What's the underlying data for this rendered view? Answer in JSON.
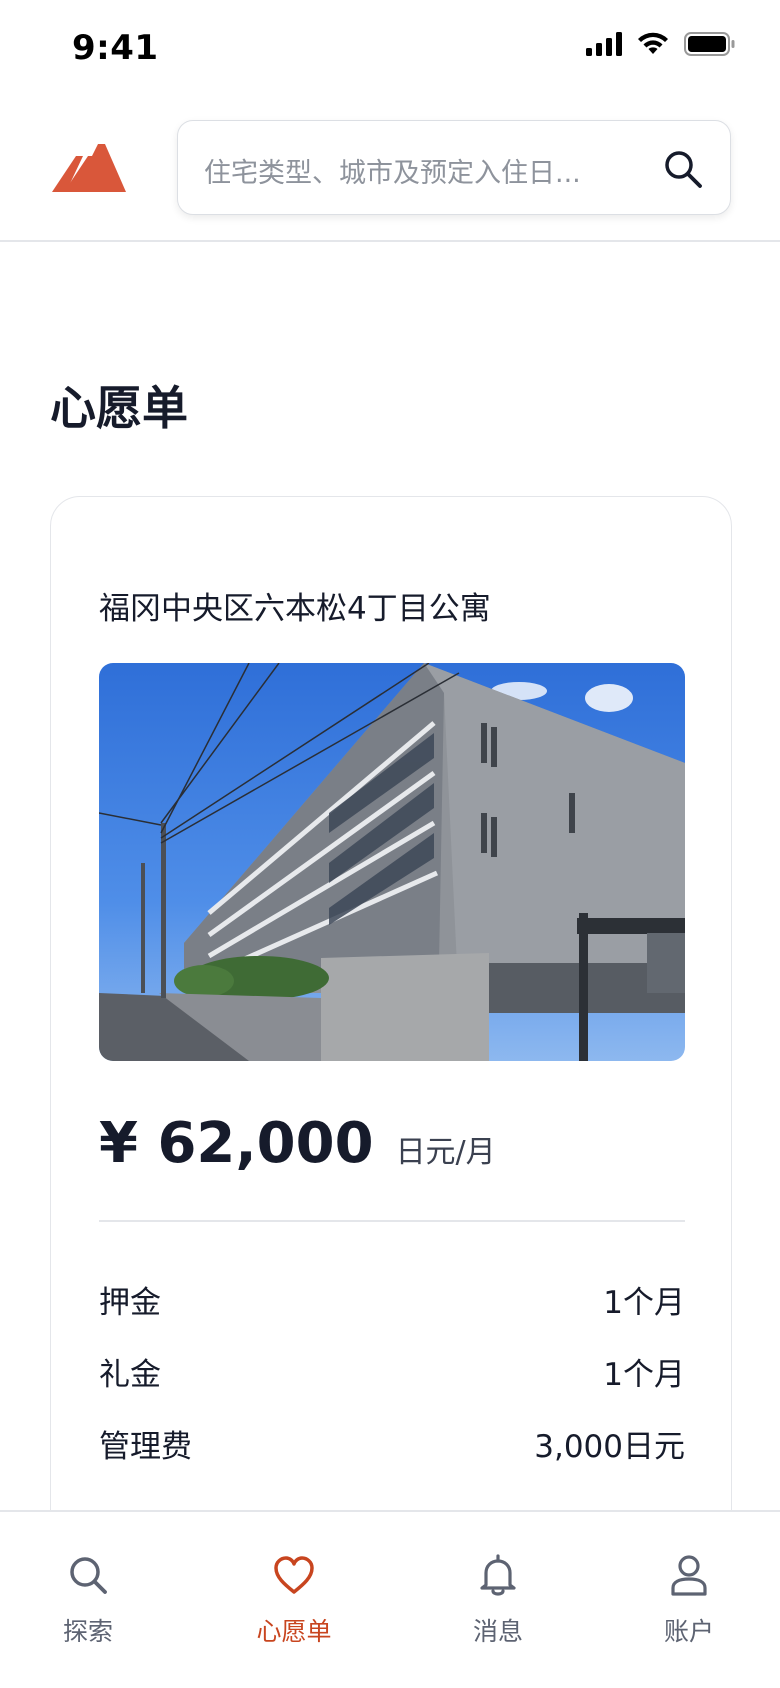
{
  "status_bar": {
    "time": "9:41"
  },
  "header": {
    "search": {
      "placeholder": "住宅类型、城市及预定入住日..."
    }
  },
  "page": {
    "title": "心愿单"
  },
  "listing": {
    "title": "福冈中央区六本松4丁目公寓",
    "price": "¥ 62,000",
    "price_unit": "日元/月",
    "fees": [
      {
        "label": "押金",
        "value": "1个月"
      },
      {
        "label": "礼金",
        "value": "1个月"
      },
      {
        "label": "管理费",
        "value": "3,000日元"
      }
    ]
  },
  "nav": {
    "items": [
      {
        "label": "探索",
        "icon": "search-icon"
      },
      {
        "label": "心愿单",
        "icon": "heart-icon",
        "active": true
      },
      {
        "label": "消息",
        "icon": "bell-icon"
      },
      {
        "label": "账户",
        "icon": "user-icon"
      }
    ]
  },
  "colors": {
    "accent": "#c8451f",
    "logo": "#d9573a",
    "text": "#161b2b",
    "muted": "#5d6372",
    "border": "#e4e6ea"
  }
}
